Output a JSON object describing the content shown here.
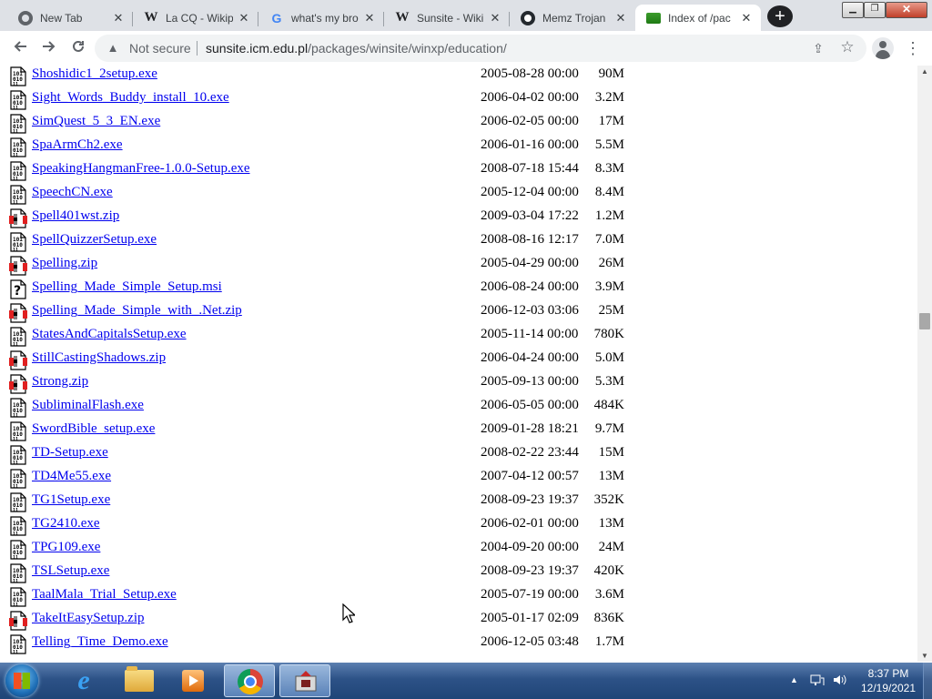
{
  "browser": {
    "tabs": [
      {
        "title": "New Tab",
        "favicon": "chrome-icon",
        "active": false
      },
      {
        "title": "La CQ - Wikip",
        "favicon": "wikipedia-icon",
        "active": false
      },
      {
        "title": "what's my bro",
        "favicon": "google-icon",
        "active": false
      },
      {
        "title": "Sunsite - Wiki",
        "favicon": "wikipedia-icon",
        "active": false
      },
      {
        "title": "Memz Trojan",
        "favicon": "github-icon",
        "active": false
      },
      {
        "title": "Index of /pac",
        "favicon": "index-icon",
        "active": true
      }
    ],
    "tab_close_glyph": "✕",
    "new_tab_glyph": "+",
    "security_label": "Not secure",
    "url_host": "sunsite.icm.edu.pl",
    "url_path": "/packages/winsite/winxp/education/"
  },
  "files": [
    {
      "name": "Shoshidic1_2setup.exe",
      "date": "2005-08-28 00:00",
      "size": "90M",
      "type": "binary"
    },
    {
      "name": "Sight_Words_Buddy_install_10.exe",
      "date": "2006-04-02 00:00",
      "size": "3.2M",
      "type": "binary"
    },
    {
      "name": "SimQuest_5_3_EN.exe",
      "date": "2006-02-05 00:00",
      "size": "17M",
      "type": "binary"
    },
    {
      "name": "SpaArmCh2.exe",
      "date": "2006-01-16 00:00",
      "size": "5.5M",
      "type": "binary"
    },
    {
      "name": "SpeakingHangmanFree-1.0.0-Setup.exe",
      "date": "2008-07-18 15:44",
      "size": "8.3M",
      "type": "binary"
    },
    {
      "name": "SpeechCN.exe",
      "date": "2005-12-04 00:00",
      "size": "8.4M",
      "type": "binary"
    },
    {
      "name": "Spell401wst.zip",
      "date": "2009-03-04 17:22",
      "size": "1.2M",
      "type": "compressed"
    },
    {
      "name": "SpellQuizzerSetup.exe",
      "date": "2008-08-16 12:17",
      "size": "7.0M",
      "type": "binary"
    },
    {
      "name": "Spelling.zip",
      "date": "2005-04-29 00:00",
      "size": "26M",
      "type": "compressed"
    },
    {
      "name": "Spelling_Made_Simple_Setup.msi",
      "date": "2006-08-24 00:00",
      "size": "3.9M",
      "type": "unknown"
    },
    {
      "name": "Spelling_Made_Simple_with_.Net.zip",
      "date": "2006-12-03 03:06",
      "size": "25M",
      "type": "compressed"
    },
    {
      "name": "StatesAndCapitalsSetup.exe",
      "date": "2005-11-14 00:00",
      "size": "780K",
      "type": "binary"
    },
    {
      "name": "StillCastingShadows.zip",
      "date": "2006-04-24 00:00",
      "size": "5.0M",
      "type": "compressed"
    },
    {
      "name": "Strong.zip",
      "date": "2005-09-13 00:00",
      "size": "5.3M",
      "type": "compressed"
    },
    {
      "name": "SubliminalFlash.exe",
      "date": "2006-05-05 00:00",
      "size": "484K",
      "type": "binary"
    },
    {
      "name": "SwordBible_setup.exe",
      "date": "2009-01-28 18:21",
      "size": "9.7M",
      "type": "binary"
    },
    {
      "name": "TD-Setup.exe",
      "date": "2008-02-22 23:44",
      "size": "15M",
      "type": "binary"
    },
    {
      "name": "TD4Me55.exe",
      "date": "2007-04-12 00:57",
      "size": "13M",
      "type": "binary"
    },
    {
      "name": "TG1Setup.exe",
      "date": "2008-09-23 19:37",
      "size": "352K",
      "type": "binary"
    },
    {
      "name": "TG2410.exe",
      "date": "2006-02-01 00:00",
      "size": "13M",
      "type": "binary"
    },
    {
      "name": "TPG109.exe",
      "date": "2004-09-20 00:00",
      "size": "24M",
      "type": "binary"
    },
    {
      "name": "TSLSetup.exe",
      "date": "2008-09-23 19:37",
      "size": "420K",
      "type": "binary"
    },
    {
      "name": "TaalMala_Trial_Setup.exe",
      "date": "2005-07-19 00:00",
      "size": "3.6M",
      "type": "binary"
    },
    {
      "name": "TakeItEasySetup.zip",
      "date": "2005-01-17 02:09",
      "size": "836K",
      "type": "compressed"
    },
    {
      "name": "Telling_Time_Demo.exe",
      "date": "2006-12-05 03:48",
      "size": "1.7M",
      "type": "binary"
    }
  ],
  "taskbar": {
    "clock_time": "8:37 PM",
    "clock_date": "12/19/2021"
  }
}
